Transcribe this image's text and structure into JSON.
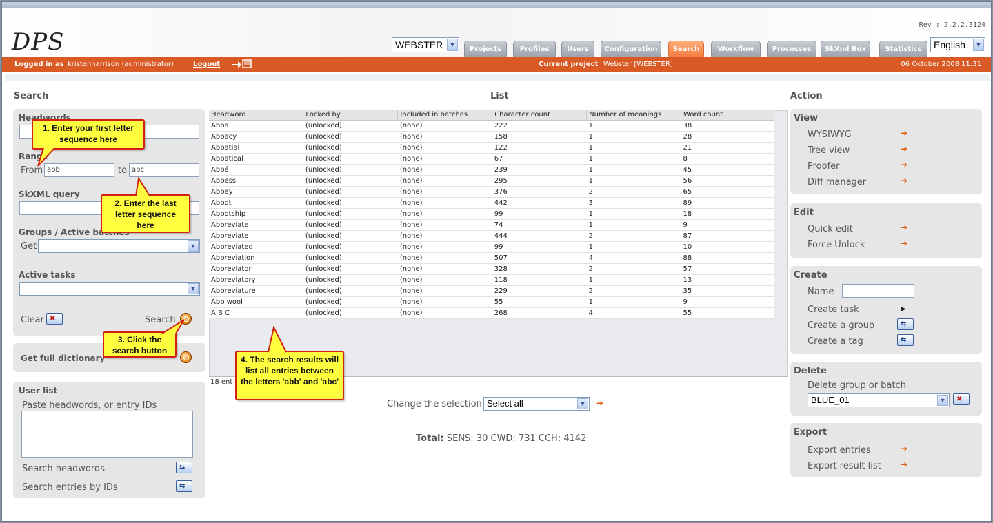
{
  "app": {
    "logo": "DPS",
    "revision": "Rev : 2.2.2.3124"
  },
  "project_select": {
    "value": "WEBSTER"
  },
  "nav": [
    "Projects",
    "Profiles",
    "Users",
    "Configuration",
    "Search",
    "Workflow",
    "Processes",
    "SkXml Box",
    "Statistics"
  ],
  "nav_active": "Search",
  "language_select": {
    "value": "English"
  },
  "status_bar": {
    "logged_in_label": "Logged in as",
    "user": "kristenharrison (administrator)",
    "logout": "Logout",
    "current_project_label": "Current project",
    "current_project": "Webster [WEBSTER]",
    "datetime": "06 October 2008 11:31"
  },
  "search_panel": {
    "title": "Search",
    "headwords_label": "Headwords",
    "range_label": "Range",
    "from_label": "From",
    "from_value": "abb",
    "to_label": "to",
    "to_value": "abc",
    "skxml_label": "SkXML query",
    "groups_label": "Groups / Active batches",
    "get_label": "Get",
    "active_tasks_label": "Active tasks",
    "clear_label": "Clear",
    "search_label": "Search",
    "full_dict_label": "Get full dictionary",
    "user_list_label": "User list",
    "paste_label": "Paste headwords, or entry IDs",
    "search_headwords_label": "Search headwords",
    "search_ids_label": "Search entries by IDs"
  },
  "list": {
    "title": "List",
    "columns": [
      "Headword",
      "Locked by",
      "Included in batches",
      "Character count",
      "Number of meanings",
      "Word count"
    ],
    "rows": [
      [
        "Abba",
        "(unlocked)",
        "(none)",
        "222",
        "1",
        "38"
      ],
      [
        "Abbacy",
        "(unlocked)",
        "(none)",
        "158",
        "1",
        "28"
      ],
      [
        "Abbatial",
        "(unlocked)",
        "(none)",
        "122",
        "1",
        "21"
      ],
      [
        "Abbatical",
        "(unlocked)",
        "(none)",
        "67",
        "1",
        "8"
      ],
      [
        "Abbé",
        "(unlocked)",
        "(none)",
        "239",
        "1",
        "45"
      ],
      [
        "Abbess",
        "(unlocked)",
        "(none)",
        "295",
        "1",
        "56"
      ],
      [
        "Abbey",
        "(unlocked)",
        "(none)",
        "376",
        "2",
        "65"
      ],
      [
        "Abbot",
        "(unlocked)",
        "(none)",
        "442",
        "3",
        "89"
      ],
      [
        "Abbotship",
        "(unlocked)",
        "(none)",
        "99",
        "1",
        "18"
      ],
      [
        "Abbreviate",
        "(unlocked)",
        "(none)",
        "74",
        "1",
        "9"
      ],
      [
        "Abbreviate",
        "(unlocked)",
        "(none)",
        "444",
        "2",
        "87"
      ],
      [
        "Abbreviated",
        "(unlocked)",
        "(none)",
        "99",
        "1",
        "10"
      ],
      [
        "Abbreviation",
        "(unlocked)",
        "(none)",
        "507",
        "4",
        "88"
      ],
      [
        "Abbreviator",
        "(unlocked)",
        "(none)",
        "328",
        "2",
        "57"
      ],
      [
        "Abbreviatory",
        "(unlocked)",
        "(none)",
        "118",
        "1",
        "13"
      ],
      [
        "Abbreviature",
        "(unlocked)",
        "(none)",
        "229",
        "2",
        "35"
      ],
      [
        "Abb wool",
        "(unlocked)",
        "(none)",
        "55",
        "1",
        "9"
      ],
      [
        "A B C",
        "(unlocked)",
        "(none)",
        "268",
        "4",
        "55"
      ]
    ],
    "entries_count": "18 ent",
    "change_selection_label": "Change the selection",
    "selection_value": "Select all",
    "total_label": "Total:",
    "total_value": "SENS: 30 CWD: 731 CCH: 4142"
  },
  "action": {
    "title": "Action",
    "view_title": "View",
    "view_items": [
      "WYSIWYG",
      "Tree view",
      "Proofer",
      "Diff manager"
    ],
    "edit_title": "Edit",
    "edit_items": [
      "Quick edit",
      "Force Unlock"
    ],
    "create_title": "Create",
    "name_label": "Name",
    "create_task": "Create task",
    "create_group": "Create a group",
    "create_tag": "Create a tag",
    "delete_title": "Delete",
    "delete_label": "Delete group or batch",
    "delete_value": "BLUE_01",
    "export_title": "Export",
    "export_entries": "Export entries",
    "export_result": "Export result list"
  },
  "callouts": {
    "c1": "1. Enter your first letter sequence here",
    "c2": "2. Enter the last letter sequence here",
    "c3": "3. Click the search button",
    "c4": "4. The search results will list all entries between the letters 'abb' and 'abc'"
  },
  "colors": {
    "accent": "#d95a25",
    "active_tab": "#f27a3c",
    "panel": "#e6e6e6"
  }
}
